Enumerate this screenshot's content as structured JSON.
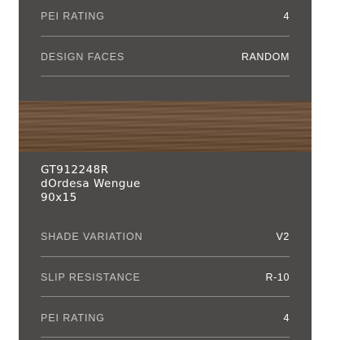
{
  "specs_top": [
    {
      "label": "PEI RATING",
      "value": "4"
    },
    {
      "label": "DESIGN FACES",
      "value": "RANDOM"
    }
  ],
  "swatch": {
    "name": "wood-texture-swatch"
  },
  "product": {
    "code": "GT912248R",
    "name": "dOrdesa Wengue",
    "size": "90x15"
  },
  "specs_bottom": [
    {
      "label": "SHADE VARIATION",
      "value": "V2"
    },
    {
      "label": "SLIP RESISTANCE",
      "value": "R-10"
    },
    {
      "label": "PEI RATING",
      "value": "4"
    }
  ],
  "colors": {
    "card_background": "#4b4a48",
    "divider": "#8c8a86",
    "label_text": "#c9c7c2",
    "value_text": "#ffffff"
  }
}
